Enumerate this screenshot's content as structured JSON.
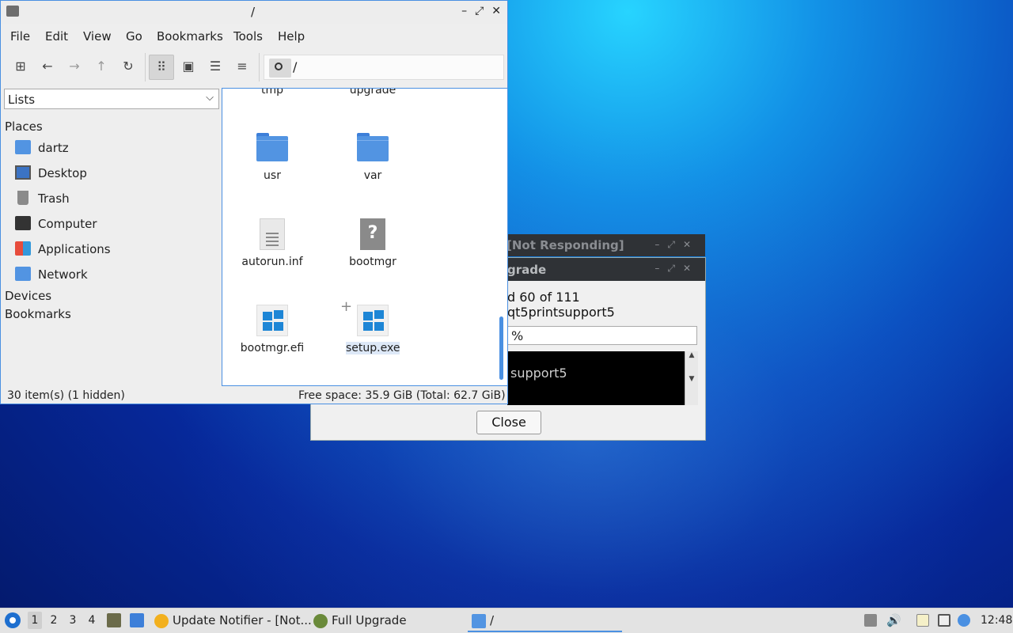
{
  "desktop": {
    "accent": "#1290e6"
  },
  "dialog_not_responding": {
    "title": "[Not Responding]"
  },
  "dialog_upgrade": {
    "title": "grade",
    "line1": "d 60 of 111",
    "line2": "qt5printsupport5",
    "progress_text": "%",
    "terminal_text": "support5",
    "close_label": "Close"
  },
  "file_manager": {
    "title": "/",
    "menu": [
      "File",
      "Edit",
      "View",
      "Go",
      "Bookmarks",
      "Tools",
      "Help"
    ],
    "path": "/",
    "side_combo": "Lists",
    "places_header": "Places",
    "places": [
      {
        "label": "dartz",
        "icon": "home-folder-icon"
      },
      {
        "label": "Desktop",
        "icon": "desktop-icon"
      },
      {
        "label": "Trash",
        "icon": "trash-icon"
      },
      {
        "label": "Computer",
        "icon": "computer-icon"
      },
      {
        "label": "Applications",
        "icon": "applications-icon"
      },
      {
        "label": "Network",
        "icon": "network-icon"
      }
    ],
    "devices_header": "Devices",
    "bookmarks_header": "Bookmarks",
    "files": [
      {
        "label": "tmp",
        "kind": "folder"
      },
      {
        "label": "upgrade",
        "kind": "folder"
      },
      {
        "label": "usr",
        "kind": "folder"
      },
      {
        "label": "var",
        "kind": "folder"
      },
      {
        "label": "autorun.inf",
        "kind": "text"
      },
      {
        "label": "bootmgr",
        "kind": "unknown"
      },
      {
        "label": "bootmgr.efi",
        "kind": "windows"
      },
      {
        "label": "setup.exe",
        "kind": "windows"
      }
    ],
    "status_left": "30 item(s) (1 hidden)",
    "status_right": "Free space: 35.9 GiB (Total: 62.7 GiB)",
    "selection_color": "#4a90e2"
  },
  "taskbar": {
    "workspaces": [
      "1",
      "2",
      "3",
      "4"
    ],
    "tasks": [
      {
        "label": "Update Notifier - [Not..."
      },
      {
        "label": "Full Upgrade"
      },
      {
        "label": "/"
      }
    ],
    "clock": "12:48"
  }
}
